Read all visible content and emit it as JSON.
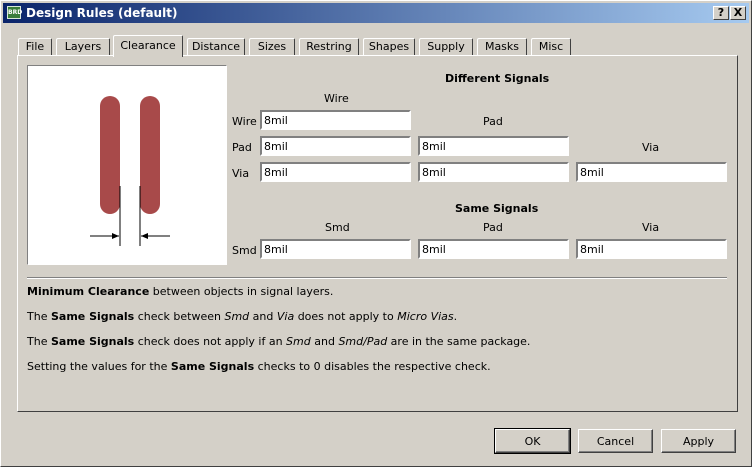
{
  "window": {
    "title": "Design Rules (default)",
    "app_icon": "EAGLE-icon",
    "help_label": "?",
    "close_label": "X",
    "titlebar_color": "#0a246a"
  },
  "tabs": [
    "File",
    "Layers",
    "Clearance",
    "Distance",
    "Sizes",
    "Restring",
    "Shapes",
    "Supply",
    "Masks",
    "Misc"
  ],
  "active_tab": "Clearance",
  "different_signals": {
    "header": "Different Signals",
    "col_wire": "Wire",
    "col_pad": "Pad",
    "col_via": "Via",
    "row_wire": "Wire",
    "row_pad": "Pad",
    "row_via": "Via",
    "wire_wire": "8mil",
    "pad_wire": "8mil",
    "pad_pad": "8mil",
    "via_wire": "8mil",
    "via_pad": "8mil",
    "via_via": "8mil"
  },
  "same_signals": {
    "header": "Same Signals",
    "col_smd": "Smd",
    "col_pad": "Pad",
    "col_via": "Via",
    "row_smd": "Smd",
    "smd_smd": "8mil",
    "smd_pad": "8mil",
    "smd_via": "8mil"
  },
  "descriptions": {
    "l1_b": "Minimum Clearance",
    "l1_t": " between objects in signal layers.",
    "l2_a": "The ",
    "l2_b": "Same Signals",
    "l2_c": " check between ",
    "l2_d": "Smd",
    "l2_e": " and ",
    "l2_f": "Via",
    "l2_g": " does not apply to ",
    "l2_h": "Micro Vias",
    "l2_i": ".",
    "l3_a": "The ",
    "l3_b": "Same Signals",
    "l3_c": " check does not apply if an ",
    "l3_d": "Smd",
    "l3_e": " and ",
    "l3_f": "Smd/Pad",
    "l3_g": " are in the same package.",
    "l4_a": "Setting the values for the ",
    "l4_b": "Same Signals",
    "l4_c": " checks to 0 disables the respective check."
  },
  "buttons": {
    "ok": "OK",
    "cancel": "Cancel",
    "apply": "Apply"
  },
  "colors": {
    "pad_fill": "#a84a4a",
    "dialog_bg": "#d4d0c8"
  }
}
